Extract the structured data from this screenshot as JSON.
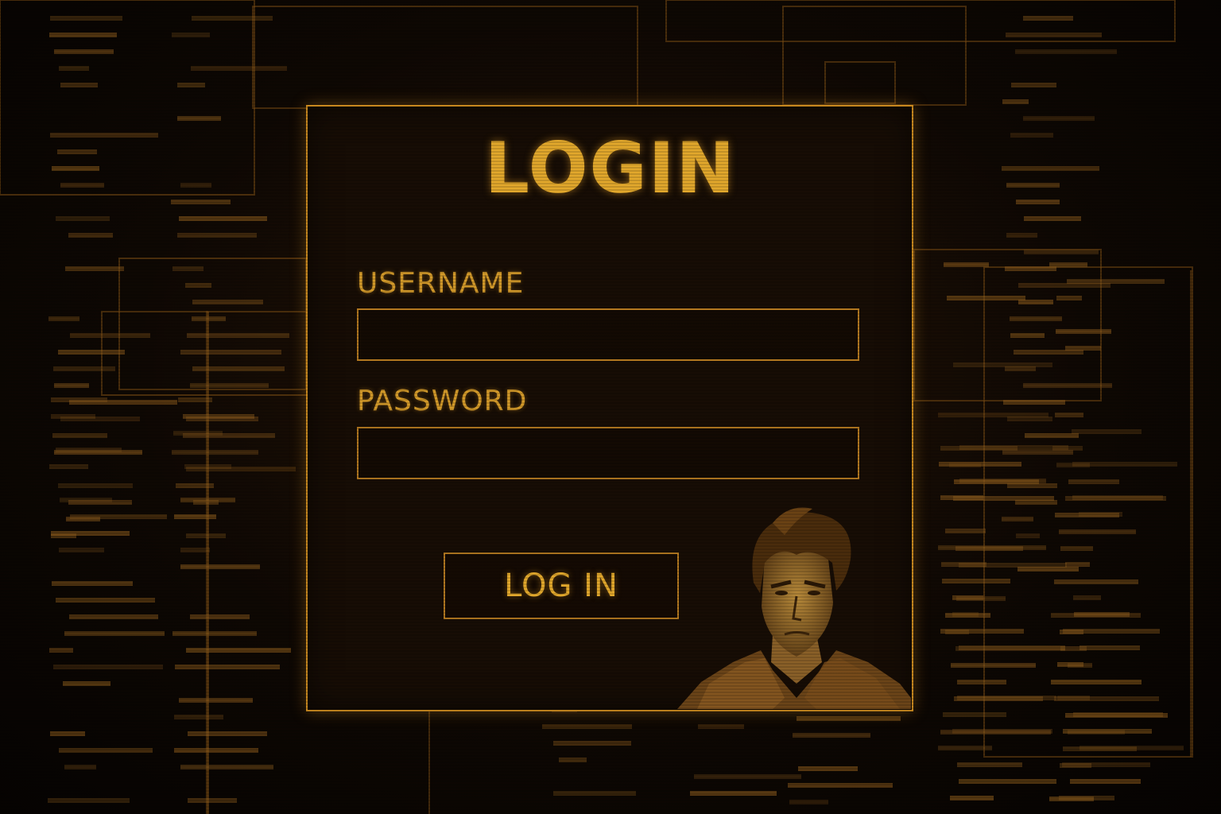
{
  "login": {
    "title": "LOGIN",
    "username_label": "USERNAME",
    "username_value": "",
    "password_label": "PASSWORD",
    "password_value": "",
    "submit_label": "LOG IN"
  },
  "theme": {
    "accent": "#e2a82c",
    "border": "#c8881f",
    "background": "#0d0703"
  },
  "icons": {
    "portrait": "character-portrait"
  }
}
